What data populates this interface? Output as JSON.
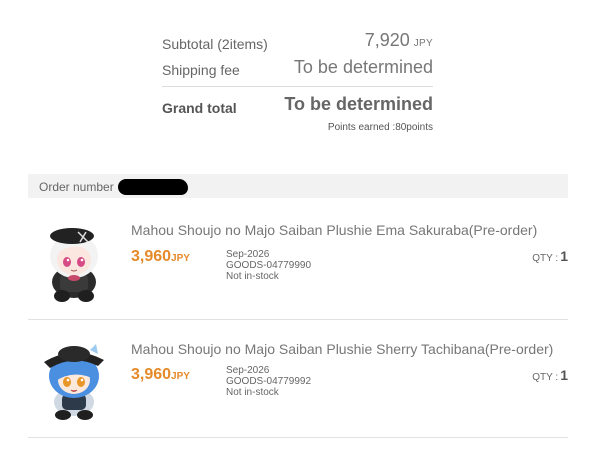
{
  "summary": {
    "subtotal_label": "Subtotal (2items)",
    "subtotal_value": "7,920",
    "subtotal_currency": "JPY",
    "shipping_label": "Shipping fee",
    "shipping_value": "To be determined",
    "grand_total_label": "Grand total",
    "grand_total_value": "To be determined",
    "points_earned": "Points earned :80points"
  },
  "order": {
    "number_label": "Order number",
    "items": [
      {
        "title": "Mahou Shoujo no Majo Saiban Plushie Ema Sakuraba(Pre-order)",
        "price": "3,960",
        "currency": "JPY",
        "release": "Sep-2026",
        "code": "GOODS-04779990",
        "stock": "Not in-stock",
        "qty_label": "QTY :",
        "qty": "1",
        "image_icon": "plushie-ema-image",
        "hair_color": "#f3f3f3",
        "hat_color": "#222222"
      },
      {
        "title": "Mahou Shoujo no Majo Saiban Plushie Sherry Tachibana(Pre-order)",
        "price": "3,960",
        "currency": "JPY",
        "release": "Sep-2026",
        "code": "GOODS-04779992",
        "stock": "Not in-stock",
        "qty_label": "QTY :",
        "qty": "1",
        "image_icon": "plushie-sherry-image",
        "hair_color": "#4a8fe0",
        "hat_color": "#222222"
      }
    ]
  },
  "colors": {
    "price": "#e58a2a",
    "header_bg": "#f2f2f2"
  }
}
